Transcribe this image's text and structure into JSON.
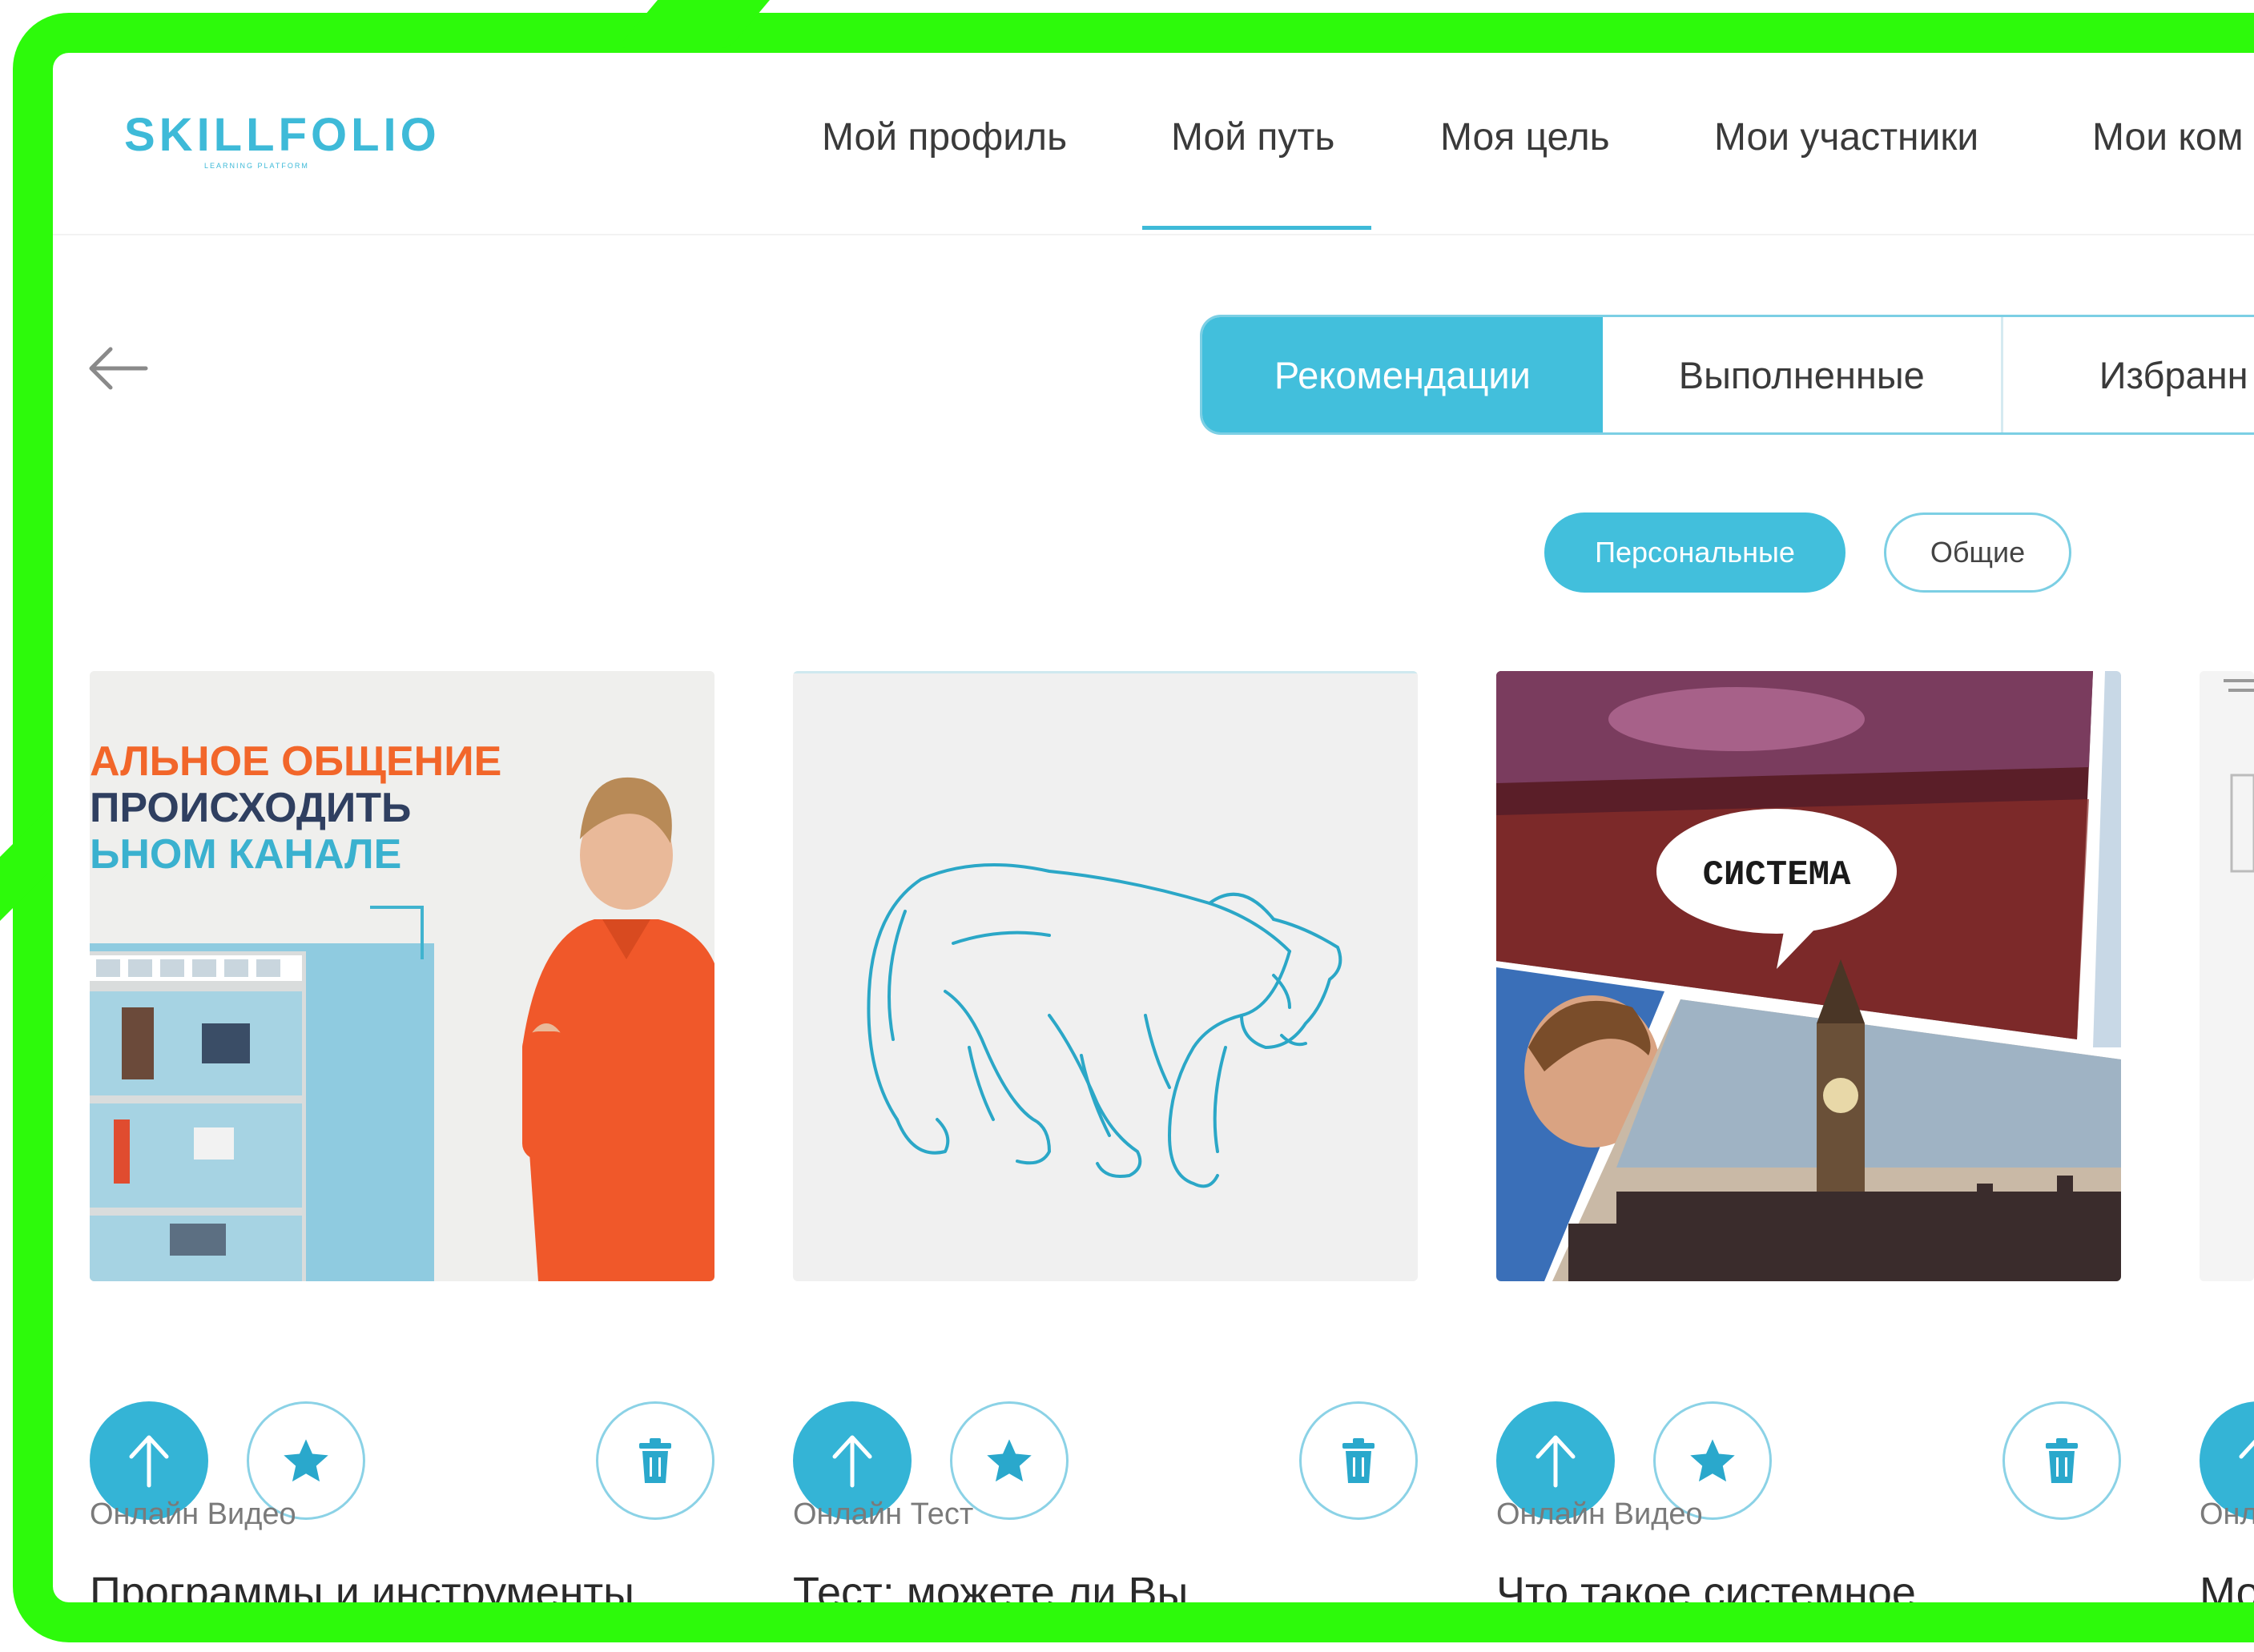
{
  "logo": {
    "name": "SKILLFOLIO",
    "subtitle": "LEARNING PLATFORM"
  },
  "nav": {
    "items": [
      "Мой профиль",
      "Мой путь",
      "Моя цель",
      "Мои участники",
      "Мои ком"
    ],
    "active_index": 1
  },
  "tabs": [
    "Рекомендации",
    "Выполненные",
    "Избранн"
  ],
  "active_tab": 0,
  "filters": {
    "personal": "Персональные",
    "common": "Общие",
    "active": "personal"
  },
  "cards": [
    {
      "type": "Онлайн Видео",
      "title": "Программы и инструменты",
      "thumb_text": [
        "АЛЬНОЕ ОБЩЕНИЕ",
        "ПРОИСХОДИТЬ",
        "ЬНОМ КАНАЛЕ"
      ]
    },
    {
      "type": "Онлайн Тест",
      "title": "Тест: можете ли Вы"
    },
    {
      "type": "Онлайн Видео",
      "title": "Что такое системное",
      "thumb_text": "СИСТЕМА"
    },
    {
      "type": "Онл",
      "title": "Мо"
    }
  ],
  "icons": {
    "back": "arrow-left-icon",
    "up": "arrow-up-icon",
    "favorite": "star-icon",
    "delete": "trash-icon"
  },
  "colors": {
    "accent": "#42bfdc",
    "frame": "#2dfa0b",
    "thumb_orange": "#f2662a"
  }
}
